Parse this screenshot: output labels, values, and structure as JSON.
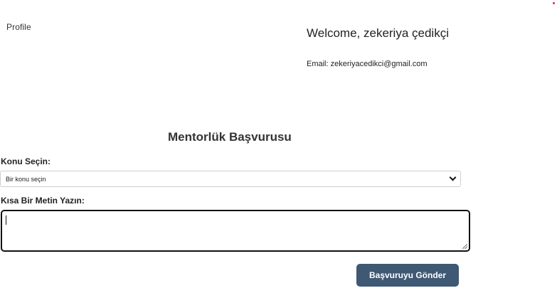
{
  "profile": {
    "image_alt": "Profile",
    "welcome": "Welcome, zekeriya çedikçi",
    "email": "Email: zekeriyacedikci@gmail.com"
  },
  "form": {
    "title": "Mentorlük Başvurusu",
    "topic_label": "Konu Seçin:",
    "topic_selected": "Bir konu seçin",
    "text_label": "Kısa Bir Metin Yazın:",
    "text_value": "",
    "submit_label": "Başvuruyu Gönder"
  },
  "colors": {
    "button_bg": "#3f5873",
    "accent_dot": "#e0245e"
  },
  "icons": {
    "select_arrow": "chevron-down-icon",
    "resize": "resize-grip-icon"
  }
}
